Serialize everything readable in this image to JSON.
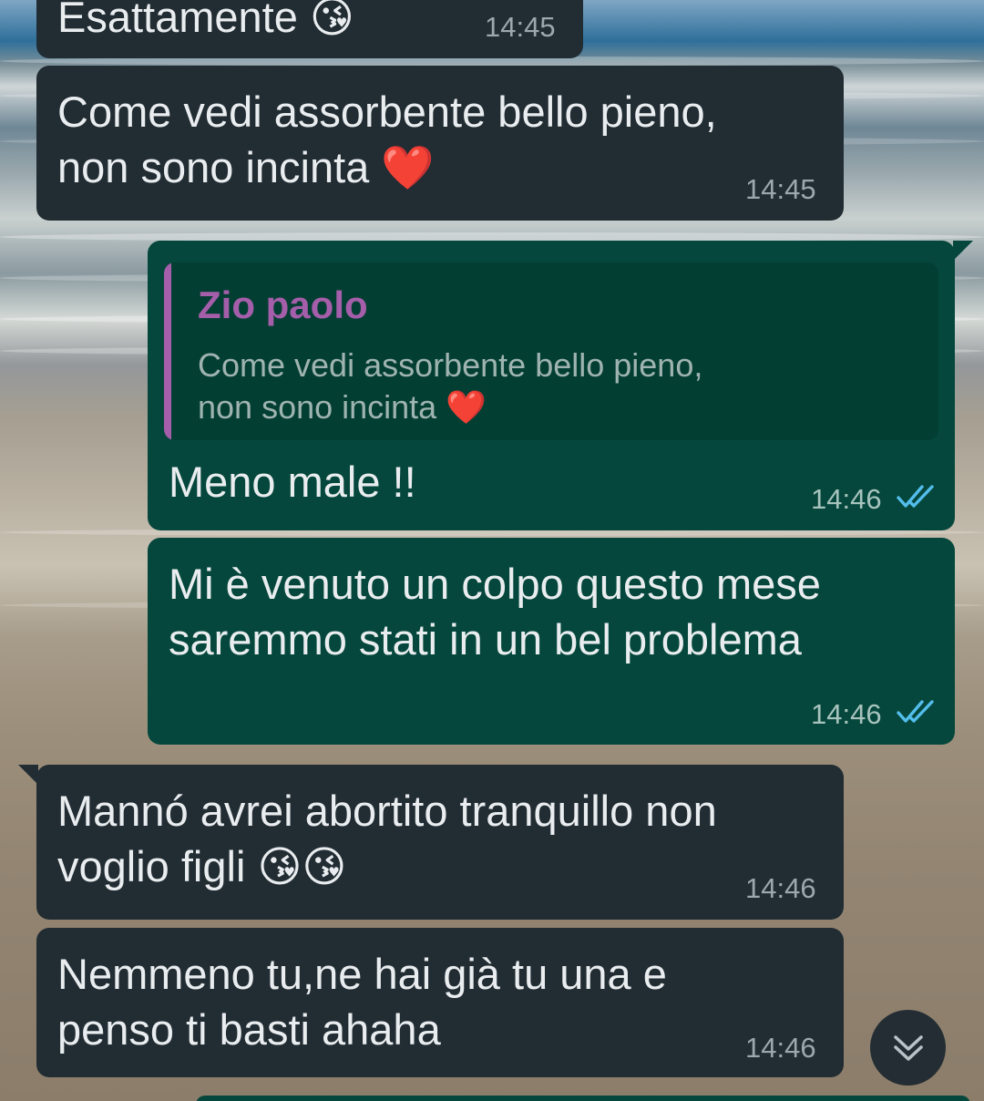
{
  "messages": [
    {
      "id": "m1",
      "direction": "incoming",
      "text": "Esattamente 😘",
      "time": "14:45"
    },
    {
      "id": "m2",
      "direction": "incoming",
      "text": "Come vedi assorbente bello pieno,\nnon sono incinta ❤️",
      "time": "14:45"
    },
    {
      "id": "m3",
      "direction": "outgoing",
      "quote": {
        "author": "Zio paolo",
        "text": "Come vedi assorbente bello pieno,\nnon sono incinta ❤️"
      },
      "text": "Meno male !!",
      "time": "14:46",
      "status": "read-double-tick"
    },
    {
      "id": "m4",
      "direction": "outgoing",
      "text": "Mi è venuto un colpo questo mese\nsaremmo stati in un bel problema",
      "time": "14:46",
      "status": "read-double-tick"
    },
    {
      "id": "m5",
      "direction": "incoming",
      "text": "Mannó avrei abortito tranquillo non\nvoglio figli 😘😘",
      "time": "14:46"
    },
    {
      "id": "m6",
      "direction": "incoming",
      "text": "Nemmeno tu,ne hai già tu una e\npenso ti basti ahaha",
      "time": "14:46"
    }
  ],
  "scroll_down_button": {
    "icon": "double-chevron-down-icon"
  },
  "colors": {
    "incoming_bubble": "#212c33",
    "outgoing_bubble": "#05473c",
    "quote_accent": "#a55ea9",
    "read_tick": "#53bdeb",
    "text": "#e9edef"
  }
}
